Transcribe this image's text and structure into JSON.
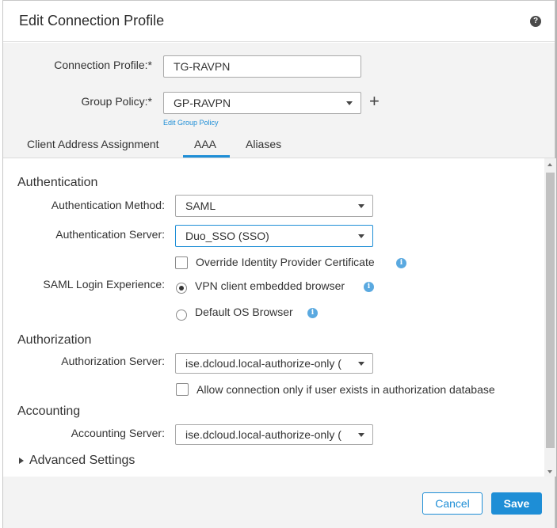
{
  "dialog": {
    "title": "Edit Connection Profile",
    "help_icon_glyph": "?"
  },
  "connection_profile": {
    "label": "Connection Profile:*",
    "value": "TG-RAVPN"
  },
  "group_policy": {
    "label": "Group Policy:*",
    "value": "GP-RAVPN",
    "add_glyph": "+",
    "edit_link": "Edit Group Policy"
  },
  "tabs": [
    {
      "label": "Client Address Assignment",
      "active": false
    },
    {
      "label": "AAA",
      "active": true
    },
    {
      "label": "Aliases",
      "active": false
    }
  ],
  "authentication": {
    "title": "Authentication",
    "method": {
      "label": "Authentication Method:",
      "value": "SAML"
    },
    "server": {
      "label": "Authentication Server:",
      "value": "Duo_SSO (SSO)"
    },
    "override_cert": {
      "label": "Override Identity Provider Certificate",
      "checked": false
    },
    "saml_login": {
      "label": "SAML Login Experience:",
      "options": [
        {
          "label": "VPN client embedded browser",
          "selected": true
        },
        {
          "label": "Default OS Browser",
          "selected": false
        }
      ]
    }
  },
  "authorization": {
    "title": "Authorization",
    "server": {
      "label": "Authorization Server:",
      "value": "ise.dcloud.local-authorize-only ("
    },
    "allow_only_if_exists": {
      "label": "Allow connection only if user exists in authorization database",
      "checked": false
    }
  },
  "accounting": {
    "title": "Accounting",
    "server": {
      "label": "Accounting Server:",
      "value": "ise.dcloud.local-authorize-only ("
    }
  },
  "advanced_settings": {
    "label": "Advanced Settings"
  },
  "footer": {
    "cancel_label": "Cancel",
    "save_label": "Save"
  },
  "icons": {
    "info": "info-icon",
    "help": "help-icon",
    "caret": "chevron-down-icon",
    "expand": "triangle-right-icon"
  },
  "colors": {
    "accent": "#1e8ed6",
    "info": "#5aa9e0",
    "panel_bg": "#f3f3f3"
  }
}
